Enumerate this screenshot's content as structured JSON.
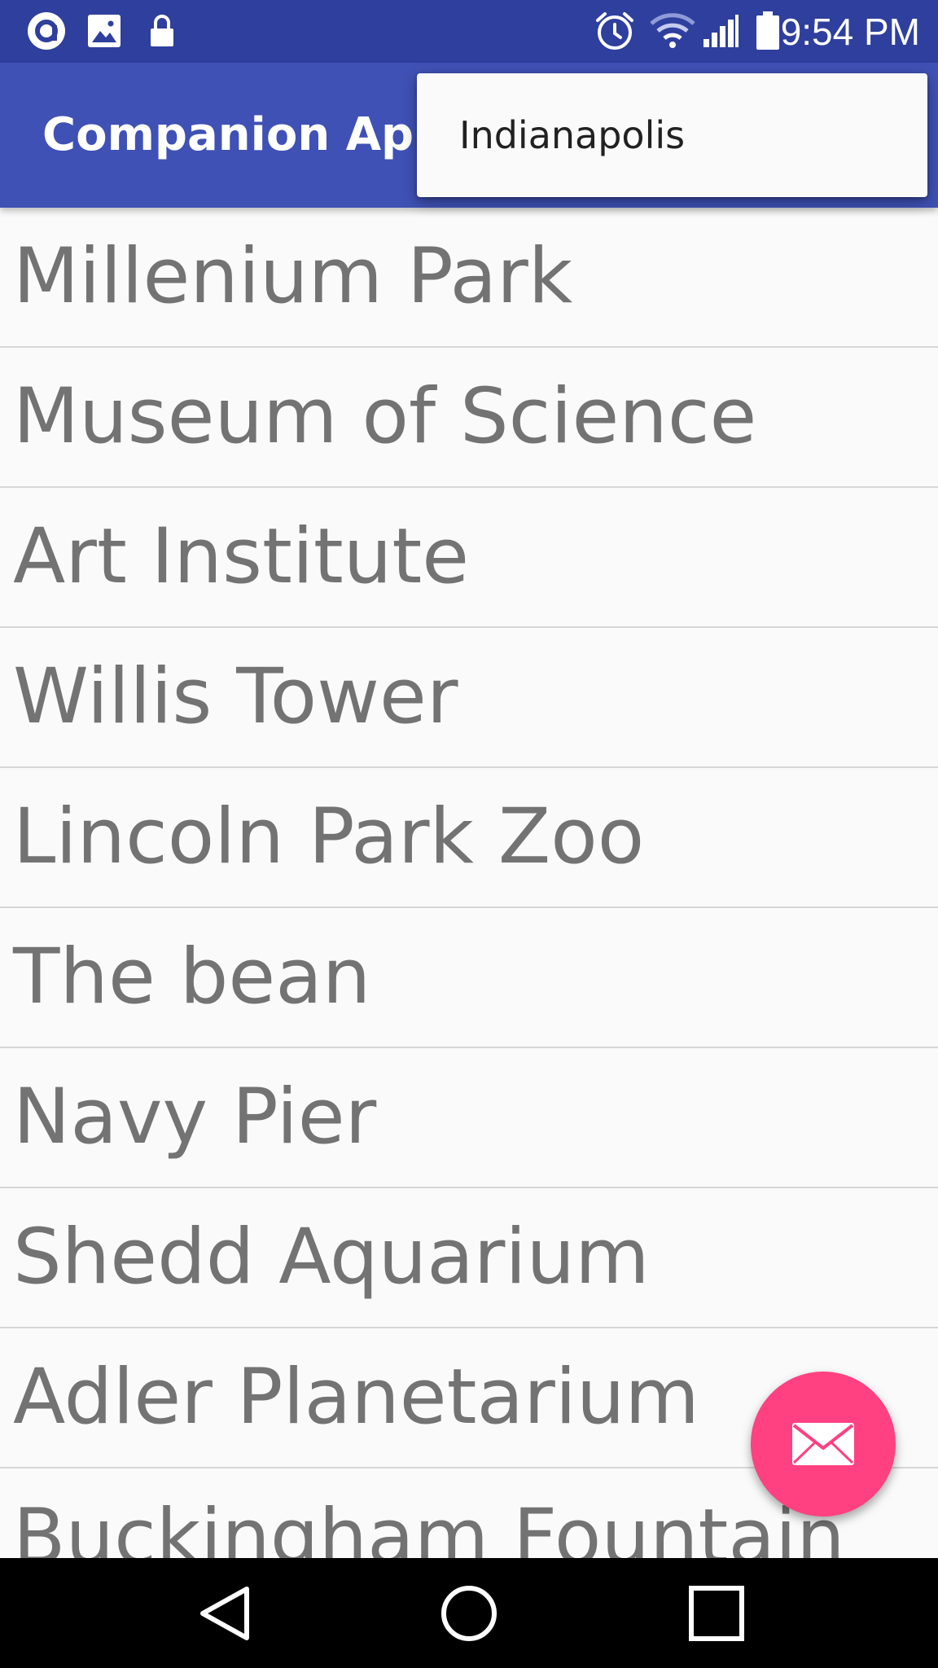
{
  "status_bar": {
    "time": "9:54 PM",
    "icons": [
      "assistant-icon",
      "image-icon",
      "lock-icon",
      "alarm-icon",
      "wifi-icon",
      "signal-icon",
      "battery-icon"
    ]
  },
  "app_bar": {
    "title": "Companion App"
  },
  "overflow_menu": {
    "items": [
      {
        "label": "Indianapolis"
      }
    ]
  },
  "list": {
    "items": [
      {
        "label": "Millenium Park"
      },
      {
        "label": "Museum of Science"
      },
      {
        "label": "Art Institute"
      },
      {
        "label": "Willis Tower"
      },
      {
        "label": "Lincoln Park Zoo"
      },
      {
        "label": "The bean"
      },
      {
        "label": "Navy Pier"
      },
      {
        "label": "Shedd Aquarium"
      },
      {
        "label": "Adler Planetarium"
      },
      {
        "label": "Buckingham Fountain"
      }
    ]
  },
  "fab": {
    "icon": "mail-icon"
  },
  "nav_bar": {
    "buttons": [
      "back-icon",
      "home-icon",
      "recents-icon"
    ]
  },
  "colors": {
    "status_bar": "#2f3f9d",
    "app_bar": "#3f51b5",
    "fab": "#ff4081",
    "list_text": "#737373",
    "divider": "#d6d6d6"
  }
}
